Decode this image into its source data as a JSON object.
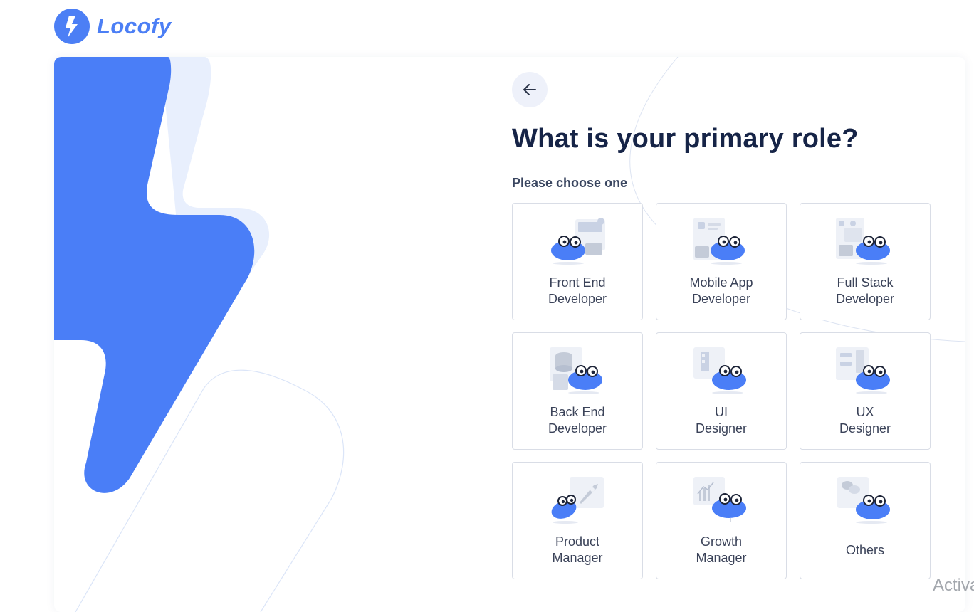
{
  "brand": {
    "name": "Locofy",
    "color": "#4c7ff5"
  },
  "icons": {
    "back": "arrow-left-icon"
  },
  "page": {
    "title": "What is your primary role?",
    "subtitle": "Please choose one"
  },
  "roles": [
    {
      "id": "front-end-developer",
      "line1": "Front End",
      "line2": "Developer",
      "illustration": "code-window"
    },
    {
      "id": "mobile-app-developer",
      "line1": "Mobile App",
      "line2": "Developer",
      "illustration": "phone"
    },
    {
      "id": "full-stack-developer",
      "line1": "Full Stack",
      "line2": "Developer",
      "illustration": "stack"
    },
    {
      "id": "back-end-developer",
      "line1": "Back End",
      "line2": "Developer",
      "illustration": "database"
    },
    {
      "id": "ui-designer",
      "line1": "UI",
      "line2": "Designer",
      "illustration": "wireframe"
    },
    {
      "id": "ux-designer",
      "line1": "UX",
      "line2": "Designer",
      "illustration": "flow"
    },
    {
      "id": "product-manager",
      "line1": "Product",
      "line2": "Manager",
      "illustration": "rocket"
    },
    {
      "id": "growth-manager",
      "line1": "Growth",
      "line2": "Manager",
      "illustration": "chart"
    },
    {
      "id": "others",
      "line1": "Others",
      "line2": "",
      "illustration": "chat-bubbles"
    }
  ],
  "watermark": "Activa"
}
